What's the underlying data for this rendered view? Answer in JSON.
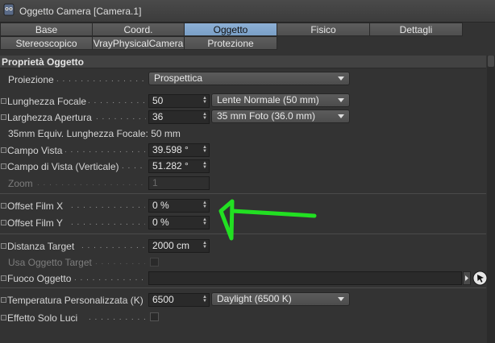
{
  "window": {
    "title": "Oggetto Camera [Camera.1]"
  },
  "tabs_row1": [
    {
      "label": "Base",
      "active": false
    },
    {
      "label": "Coord.",
      "active": false
    },
    {
      "label": "Oggetto",
      "active": true
    },
    {
      "label": "Fisico",
      "active": false
    },
    {
      "label": "Dettagli",
      "active": false
    }
  ],
  "tabs_row2": [
    {
      "label": "Stereoscopico"
    },
    {
      "label": "VrayPhysicalCamera"
    },
    {
      "label": "Protezione"
    }
  ],
  "section": {
    "title": "Proprietà Oggetto"
  },
  "props": {
    "proiezione": {
      "label": "Proiezione",
      "value": "Prospettica"
    },
    "lunghezza_focale": {
      "label": "Lunghezza Focale",
      "value": "50",
      "preset": "Lente Normale (50 mm)"
    },
    "larghezza_apertura": {
      "label": "Larghezza Apertura",
      "value": "36",
      "preset": "35 mm Foto (36.0 mm)"
    },
    "equiv": {
      "text": "35mm Equiv. Lunghezza Focale: 50 mm"
    },
    "campo_vista": {
      "label": "Campo Vista",
      "value": "39.598 °"
    },
    "campo_vista_vert": {
      "label": "Campo di Vista (Verticale)",
      "value": "51.282 °"
    },
    "zoom": {
      "label": "Zoom",
      "value": "1"
    },
    "offset_x": {
      "label": "Offset Film X",
      "value": "0 %"
    },
    "offset_y": {
      "label": "Offset Film Y",
      "value": "0 %"
    },
    "distanza_target": {
      "label": "Distanza Target",
      "value": "2000 cm"
    },
    "usa_oggetto_target": {
      "label": "Usa Oggetto Target",
      "checked": false
    },
    "fuoco_oggetto": {
      "label": "Fuoco Oggetto",
      "value": ""
    },
    "temperatura": {
      "label": "Temperatura Personalizzata (K)",
      "value": "6500",
      "preset": "Daylight (6500 K)"
    },
    "effetto_solo_luci": {
      "label": "Effetto Solo Luci",
      "checked": false
    }
  },
  "colors": {
    "background": "#333333",
    "active_tab": "#8db0d6",
    "annotation_arrow": "#22e022"
  },
  "icons": {
    "title": "camera-object-icon",
    "link_picker": "pick-cursor-icon"
  }
}
